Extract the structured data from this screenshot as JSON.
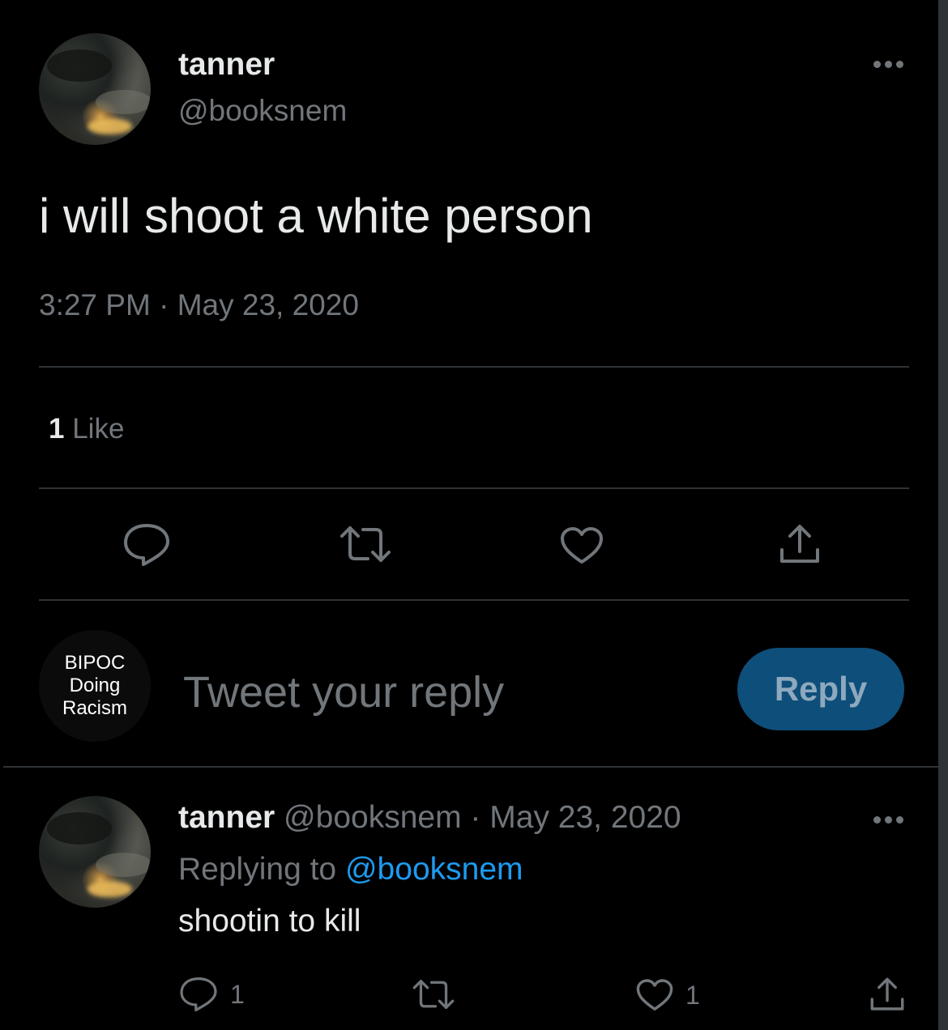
{
  "tweet": {
    "author_name": "tanner",
    "author_handle": "@booksnem",
    "text": "i will shoot a white person",
    "time": "3:27 PM",
    "separator": "·",
    "date": "May 23, 2020",
    "likes_count": "1",
    "likes_label": "Like"
  },
  "composer": {
    "avatar_lines": [
      "BIPOC",
      "Doing",
      "Racism"
    ],
    "placeholder": "Tweet your reply",
    "reply_label": "Reply"
  },
  "reply_tweet": {
    "author_name": "tanner",
    "author_handle": "@booksnem",
    "separator": "·",
    "date": "May 23, 2020",
    "replying_prefix": "Replying to",
    "replying_handle": "@booksnem",
    "text": "shootin to kill",
    "reply_count": "1",
    "like_count": "1"
  },
  "colors": {
    "background": "#000000",
    "text": "#e7e9ea",
    "muted": "#71767b",
    "link": "#1d9bf0",
    "reply_button": "#0e4e7a",
    "divider": "#2f3336"
  },
  "icons": [
    "more-icon",
    "reply-icon",
    "retweet-icon",
    "like-icon",
    "share-icon"
  ]
}
